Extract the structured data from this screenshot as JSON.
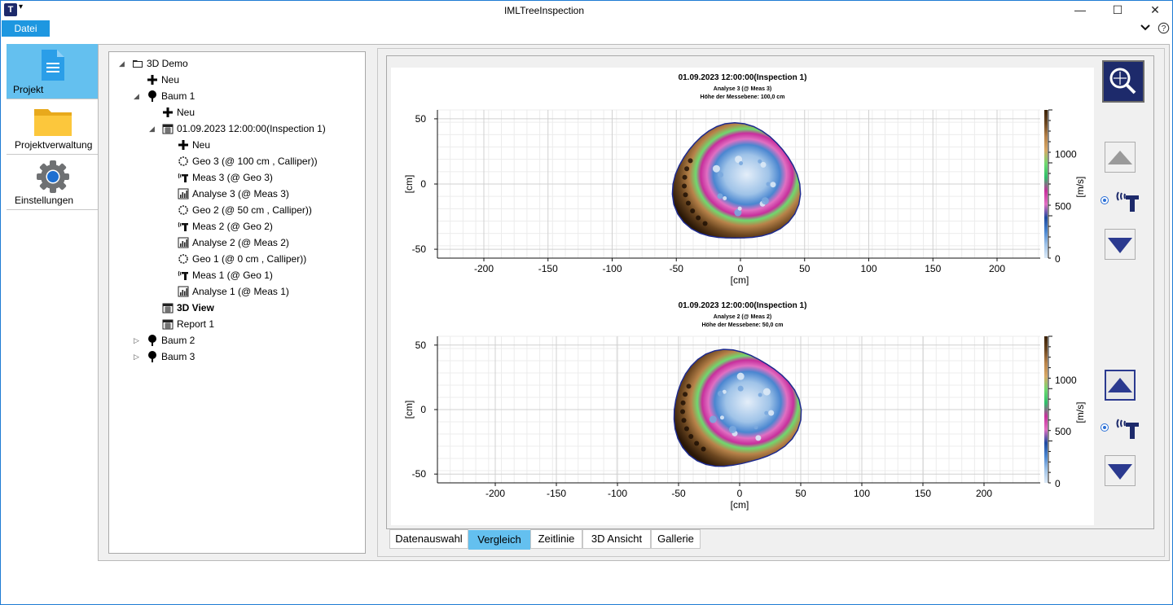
{
  "window": {
    "title": "IMLTreeInspection",
    "app_icon_letter": "T"
  },
  "menu": {
    "datei": "Datei"
  },
  "nav": [
    {
      "label": "Projekt",
      "icon": "document-icon",
      "selected": true
    },
    {
      "label": "Projektverwaltung",
      "icon": "folder-icon",
      "selected": false
    },
    {
      "label": "Einstellungen",
      "icon": "gear-icon",
      "selected": false
    }
  ],
  "tree": [
    {
      "label": "3D Demo",
      "icon": "folder-icon",
      "level": 0,
      "exp": "◢"
    },
    {
      "label": "Neu",
      "icon": "plus-icon",
      "level": 1
    },
    {
      "label": "Baum 1",
      "icon": "tree-icon",
      "level": 1,
      "exp": "◢"
    },
    {
      "label": "Neu",
      "icon": "plus-icon",
      "level": 2
    },
    {
      "label": "01.09.2023 12:00:00(Inspection 1)",
      "icon": "calendar-icon",
      "level": 2,
      "exp": "◢"
    },
    {
      "label": "Neu",
      "icon": "plus-icon",
      "level": 3
    },
    {
      "label": "Geo 3 (@ 100 cm , Calliper))",
      "icon": "geo-icon",
      "level": 3
    },
    {
      "label": "Meas 3 (@ Geo 3)",
      "icon": "meas-icon",
      "level": 3
    },
    {
      "label": "Analyse 3 (@ Meas 3)",
      "icon": "analysis-icon",
      "level": 3
    },
    {
      "label": "Geo 2 (@ 50 cm , Calliper))",
      "icon": "geo-icon",
      "level": 3
    },
    {
      "label": "Meas 2 (@ Geo 2)",
      "icon": "meas-icon",
      "level": 3
    },
    {
      "label": "Analyse 2 (@ Meas 2)",
      "icon": "analysis-icon",
      "level": 3
    },
    {
      "label": "Geo 1 (@ 0 cm , Calliper))",
      "icon": "geo-icon",
      "level": 3
    },
    {
      "label": "Meas 1 (@ Geo 1)",
      "icon": "meas-icon",
      "level": 3
    },
    {
      "label": "Analyse 1 (@ Meas 1)",
      "icon": "analysis-icon",
      "level": 3
    },
    {
      "label": "3D View",
      "icon": "calendar-icon",
      "level": 2,
      "bold": true
    },
    {
      "label": "Report 1",
      "icon": "calendar-icon",
      "level": 2
    },
    {
      "label": "Baum 2",
      "icon": "tree-icon",
      "level": 1,
      "exp": "▷"
    },
    {
      "label": "Baum 3",
      "icon": "tree-icon",
      "level": 1,
      "exp": "▷"
    }
  ],
  "tabs": [
    "Datenauswahl",
    "Vergleich",
    "Zeitlinie",
    "3D Ansicht",
    "Gallerie"
  ],
  "active_tab": "Vergleich",
  "colors": {
    "accent": "#1e97e0",
    "selected": "#64c0ef",
    "nav_dark": "#1d2a6b",
    "ramp": [
      "#3b2208",
      "#6b4620",
      "#b8834a",
      "#d8a865",
      "#6fd96f",
      "#2fbf6a",
      "#c72f9c",
      "#e06fc2",
      "#1e4aa0",
      "#4a86d0",
      "#9fc3e8",
      "#dce9f6"
    ]
  },
  "charts": [
    {
      "title": "01.09.2023 12:00:00(Inspection 1)",
      "subtitle1": "Analyse 3 (@ Meas 3)",
      "subtitle2": "Höhe der Messebene: 100,0 cm",
      "xlabel": "[cm]",
      "ylabel": "[cm]",
      "clabel": "[m/s]",
      "xticks": [
        "-200",
        "-150",
        "-100",
        "-50",
        "0",
        "50",
        "100",
        "150",
        "200"
      ],
      "yticks": [
        "50",
        "0",
        "-50"
      ],
      "cticks": [
        "1000",
        "500",
        "0"
      ]
    },
    {
      "title": "01.09.2023 12:00:00(Inspection 1)",
      "subtitle1": "Analyse 2 (@ Meas 2)",
      "subtitle2": "Höhe der Messebene: 50,0 cm",
      "xlabel": "[cm]",
      "ylabel": "[cm]",
      "clabel": "[m/s]",
      "xticks": [
        "-200",
        "-150",
        "-100",
        "-50",
        "0",
        "50",
        "100",
        "150",
        "200"
      ],
      "yticks": [
        "50",
        "0",
        "-50"
      ],
      "cticks": [
        "1000",
        "500",
        "0"
      ]
    }
  ]
}
